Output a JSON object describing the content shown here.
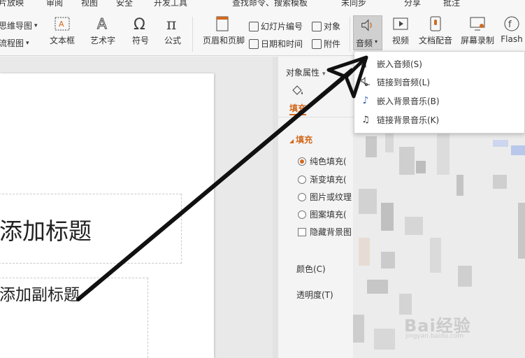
{
  "menu": [
    "片放映",
    "审阅",
    "视图",
    "安全",
    "开发工具",
    "查找命令、搜索模板",
    "未同步",
    "分享",
    "批注"
  ],
  "ribbon": {
    "mindmap": "思维导图",
    "flowchart": "流程图",
    "textbox": "文本框",
    "wordart": "艺术字",
    "symbol": "符号",
    "formula": "公式",
    "header_footer": "页眉和页脚",
    "slide_number": "幻灯片编号",
    "object": "对象",
    "date_time": "日期和时间",
    "attachment": "附件",
    "audio": "音频",
    "video": "视频",
    "doc_dubbing": "文档配音",
    "screen_record": "屏幕录制",
    "flash": "Flash"
  },
  "audio_menu": [
    {
      "label": "嵌入音频(S)",
      "icon": "speaker-icon"
    },
    {
      "label": "链接到音频(L)",
      "icon": "speaker-link-icon"
    },
    {
      "label": "嵌入背景音乐(B)",
      "icon": "music-note-icon"
    },
    {
      "label": "链接背景音乐(K)",
      "icon": "music-link-icon"
    }
  ],
  "slide": {
    "title_placeholder": "添加标题",
    "subtitle_placeholder": "添加副标题"
  },
  "pane": {
    "header": "对象属性",
    "tab_fill": "填充",
    "section_fill": "填充",
    "options": [
      {
        "label": "纯色填充(",
        "checked": true
      },
      {
        "label": "渐变填充(",
        "checked": false
      },
      {
        "label": "图片或纹理",
        "checked": false
      },
      {
        "label": "图案填充(",
        "checked": false
      }
    ],
    "hide_bg": "隐藏背景图",
    "color_label": "颜色(C)",
    "transparency_label": "透明度(T)"
  },
  "watermark": "Bai经验",
  "watermark_sub": "jingyan.baidu.com",
  "colors": {
    "accent": "#d2691e",
    "selected_btn": "#d0d0d0"
  }
}
